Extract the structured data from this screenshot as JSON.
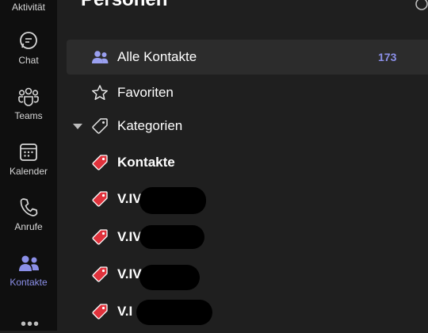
{
  "rail": {
    "top_label": "Aktivität",
    "items": [
      {
        "label": "Chat",
        "icon": "chat-icon"
      },
      {
        "label": "Teams",
        "icon": "teams-icon"
      },
      {
        "label": "Kalender",
        "icon": "calendar-icon"
      },
      {
        "label": "Anrufe",
        "icon": "phone-icon"
      },
      {
        "label": "Kontakte",
        "icon": "contacts-icon"
      }
    ],
    "more": "•••"
  },
  "main": {
    "title": "Personen",
    "nav": [
      {
        "label": "Alle Kontakte",
        "icon": "people-icon",
        "count": "173"
      },
      {
        "label": "Favoriten",
        "icon": "star-icon"
      },
      {
        "label": "Kategorien",
        "icon": "tag-outline-icon"
      }
    ],
    "categories": [
      {
        "label": "Kontakte",
        "icon": "red-tag-icon"
      },
      {
        "label": "V.IV",
        "icon": "red-tag-icon"
      },
      {
        "label": "V.IV",
        "icon": "red-tag-icon"
      },
      {
        "label": "V.IV",
        "icon": "red-tag-icon"
      },
      {
        "label": "V.I",
        "icon": "red-tag-icon"
      }
    ]
  },
  "colors": {
    "accent": "#8b8fe8",
    "tag_red": "#e0323c",
    "rail_bg": "#0f0f0f",
    "main_bg": "#1f1f1f"
  }
}
